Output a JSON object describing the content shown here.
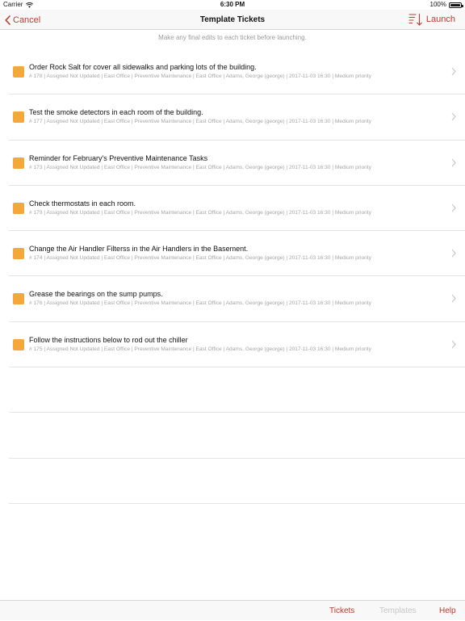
{
  "status_bar": {
    "carrier": "Carrier",
    "time": "6:30 PM",
    "battery": "100%",
    "wifi_icon": "wifi-icon",
    "battery_icon": "battery-icon"
  },
  "nav": {
    "cancel_label": "Cancel",
    "title": "Template Tickets",
    "launch_label": "Launch",
    "sort_icon": "sort-icon",
    "accent_color": "#c0392b"
  },
  "hint": "Make any final edits to each ticket before launching.",
  "tickets": [
    {
      "title": "Order Rock Salt for cover all sidewalks and parking lots of the building.",
      "meta": "# 178 | Assigned Not Updated | East Office | Preventive Maintenance | East Office | Adams, George (george) | 2017-11-03 16:30 | Medium priority"
    },
    {
      "title": "Test the smoke detectors in each room of the building.",
      "meta": "# 177 | Assigned Not Updated | East Office | Preventive Maintenance | East Office | Adams, George (george) | 2017-11-03 16:30 | Medium priority"
    },
    {
      "title": "Reminder for February's Preventive Maintenance Tasks",
      "meta": "# 173 | Assigned Not Updated | East Office | Preventive Maintenance | East Office | Adams, George (george) | 2017-11-03 16:30 | Medium priority"
    },
    {
      "title": "Check thermostats in each room.",
      "meta": "# 179 | Assigned Not Updated | East Office | Preventive Maintenance | East Office | Adams, George (george) | 2017-11-03 16:30 | Medium priority"
    },
    {
      "title": "Change the Air Handler Filterss in the Air Handlers in the Basement.",
      "meta": "# 174 | Assigned Not Updated | East Office | Preventive Maintenance | East Office | Adams, George (george) | 2017-11-03 16:30 | Medium priority"
    },
    {
      "title": "Grease the bearings on the sump pumps.",
      "meta": "# 176 | Assigned Not Updated | East Office | Preventive Maintenance | East Office | Adams, George (george) | 2017-11-03 16:30 | Medium priority"
    },
    {
      "title": "Follow the instructions below to rod out the chiller",
      "meta": "# 175 | Assigned Not Updated | East Office | Preventive Maintenance | East Office | Adams, George (george) | 2017-11-03 16:30 | Medium priority"
    }
  ],
  "ticket_swatch_color": "#f5a73b",
  "tab_bar": {
    "tickets_label": "Tickets",
    "templates_label": "Templates",
    "help_label": "Help"
  }
}
